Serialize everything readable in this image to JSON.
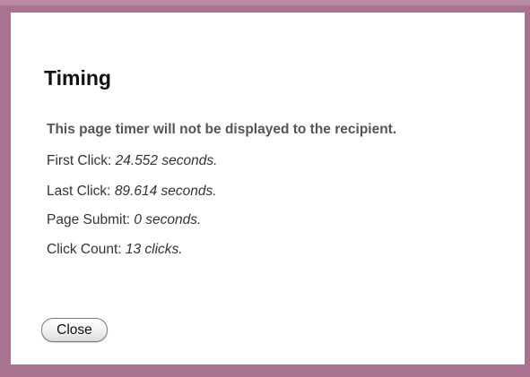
{
  "dialog": {
    "title": "Timing",
    "notice": "This page timer will not be displayed to the recipient.",
    "rows": [
      {
        "label": "First Click:",
        "value": "24.552 seconds."
      },
      {
        "label": "Last Click:",
        "value": "89.614 seconds."
      },
      {
        "label": "Page Submit:",
        "value": "0 seconds."
      },
      {
        "label": "Click Count:",
        "value": "13 clicks."
      }
    ],
    "close_label": "Close"
  },
  "colors": {
    "frame": "#a9728e",
    "background": "#ffffff",
    "title": "#111111",
    "notice": "#555555"
  }
}
